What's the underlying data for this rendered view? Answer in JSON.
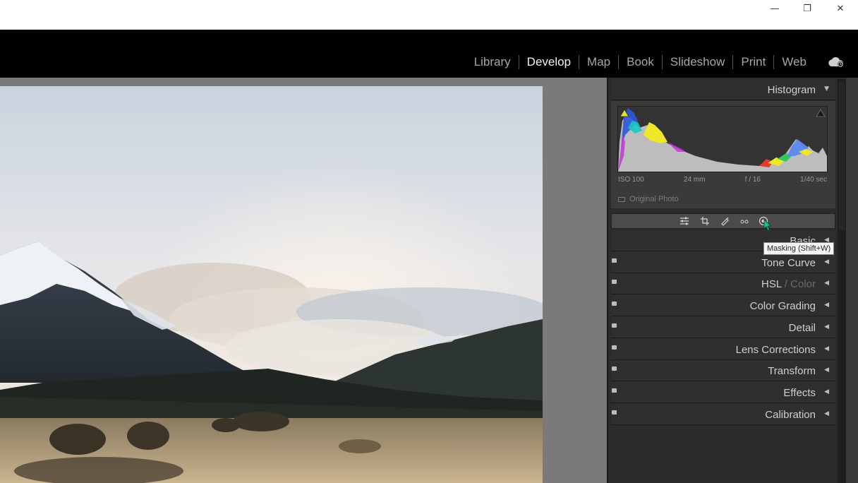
{
  "window_controls": {
    "minimize": "—",
    "maximize": "❐",
    "close": "✕"
  },
  "modules": [
    {
      "label": "Library",
      "active": false
    },
    {
      "label": "Develop",
      "active": true
    },
    {
      "label": "Map",
      "active": false
    },
    {
      "label": "Book",
      "active": false
    },
    {
      "label": "Slideshow",
      "active": false
    },
    {
      "label": "Print",
      "active": false
    },
    {
      "label": "Web",
      "active": false
    }
  ],
  "histogram": {
    "title": "Histogram",
    "iso": "ISO 100",
    "focal": "24 mm",
    "aperture": "f / 16",
    "shutter": "1/40 sec",
    "original_label": "Original Photo"
  },
  "tooltip": "Masking (Shift+W)",
  "panels": {
    "basic": "Basic",
    "tone_curve": "Tone Curve",
    "hsl": "HSL",
    "hsl_sep": " / ",
    "color": "Color",
    "color_grading": "Color Grading",
    "detail": "Detail",
    "lens_corrections": "Lens Corrections",
    "transform": "Transform",
    "effects": "Effects",
    "calibration": "Calibration"
  },
  "colors": {
    "panel_bg": "#2b2b2b",
    "header_bg": "#2f2f2f",
    "cursor": "#19c48a"
  }
}
